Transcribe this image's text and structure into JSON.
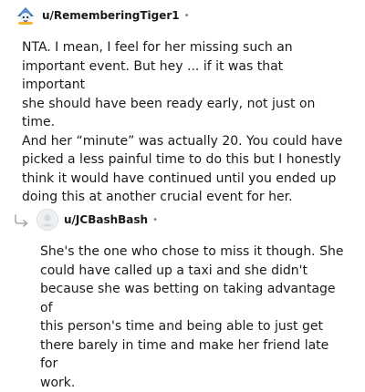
{
  "comments": [
    {
      "username": "u/RememberingTiger1",
      "separator": "•",
      "avatar_icon": "tiger-avatar-icon",
      "text": "NTA. I mean, I feel for her missing such an\nimportant event. But hey ... if it was that important\nshe should have been ready early, not just on time.\nAnd her “minute” was actually 20. You could have\npicked a less painful time to do this but I honestly\nthink it would have continued until you ended up\ndoing this at another crucial event for her."
    },
    {
      "username": "u/JCBashBash",
      "separator": "•",
      "avatar_icon": "default-avatar-icon",
      "reply_icon": "reply-arrow-icon",
      "text": "She's the one who chose to miss it though. She\ncould have called up a taxi and she didn't\nbecause she was betting on taking advantage of\nthis person's time and being able to just get\nthere barely in time and make her friend late for\nwork."
    }
  ],
  "colors": {
    "text": "#1a1a1b",
    "meta": "#7c7c7c",
    "reply_arrow": "#a8aaab",
    "avatar_border": "#d7dadc"
  }
}
